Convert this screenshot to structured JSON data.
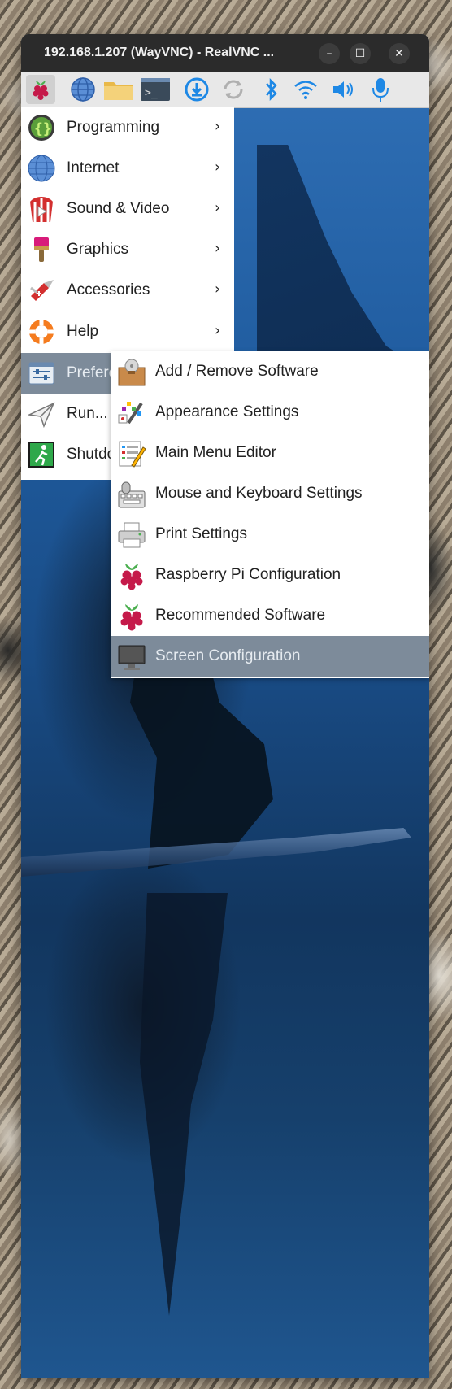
{
  "window": {
    "title": "192.168.1.207 (WayVNC) - RealVNC ...",
    "minimize_glyph": "–",
    "maximize_glyph": "☐",
    "close_glyph": "✕"
  },
  "taskbar": {
    "icons": [
      "raspberry-pi-menu-icon",
      "web-browser-icon",
      "file-manager-icon",
      "terminal-icon",
      "updates-icon",
      "sync-icon",
      "bluetooth-icon",
      "wifi-icon",
      "volume-icon",
      "microphone-icon"
    ],
    "terminal_prompt": ">_"
  },
  "menu": {
    "items": [
      {
        "label": "Programming",
        "icon": "programming-icon",
        "arrow": "›"
      },
      {
        "label": "Internet",
        "icon": "internet-icon",
        "arrow": "›"
      },
      {
        "label": "Sound & Video",
        "icon": "sound-video-icon",
        "arrow": "›"
      },
      {
        "label": "Graphics",
        "icon": "graphics-icon",
        "arrow": "›"
      },
      {
        "label": "Accessories",
        "icon": "accessories-icon",
        "arrow": "›"
      },
      {
        "label": "Help",
        "icon": "help-icon",
        "arrow": "›"
      },
      {
        "label": "Prefere",
        "icon": "preferences-icon"
      },
      {
        "label": "Run...",
        "icon": "run-icon"
      },
      {
        "label": "Shutdo",
        "icon": "shutdown-icon"
      }
    ]
  },
  "submenu": {
    "items": [
      {
        "label": "Add / Remove Software",
        "icon": "package-icon"
      },
      {
        "label": "Appearance Settings",
        "icon": "appearance-icon"
      },
      {
        "label": "Main Menu Editor",
        "icon": "menu-editor-icon"
      },
      {
        "label": "Mouse and Keyboard Settings",
        "icon": "mouse-keyboard-icon"
      },
      {
        "label": "Print Settings",
        "icon": "printer-icon"
      },
      {
        "label": "Raspberry Pi Configuration",
        "icon": "raspberry-pi-icon"
      },
      {
        "label": "Recommended Software",
        "icon": "raspberry-pi-icon"
      },
      {
        "label": "Screen Configuration",
        "icon": "monitor-icon"
      }
    ]
  },
  "colors": {
    "highlight": "#7d8b9a",
    "titlebar": "#2b2b2b",
    "taskbar": "#e8e8e8",
    "accent_blue": "#1e88e5"
  }
}
